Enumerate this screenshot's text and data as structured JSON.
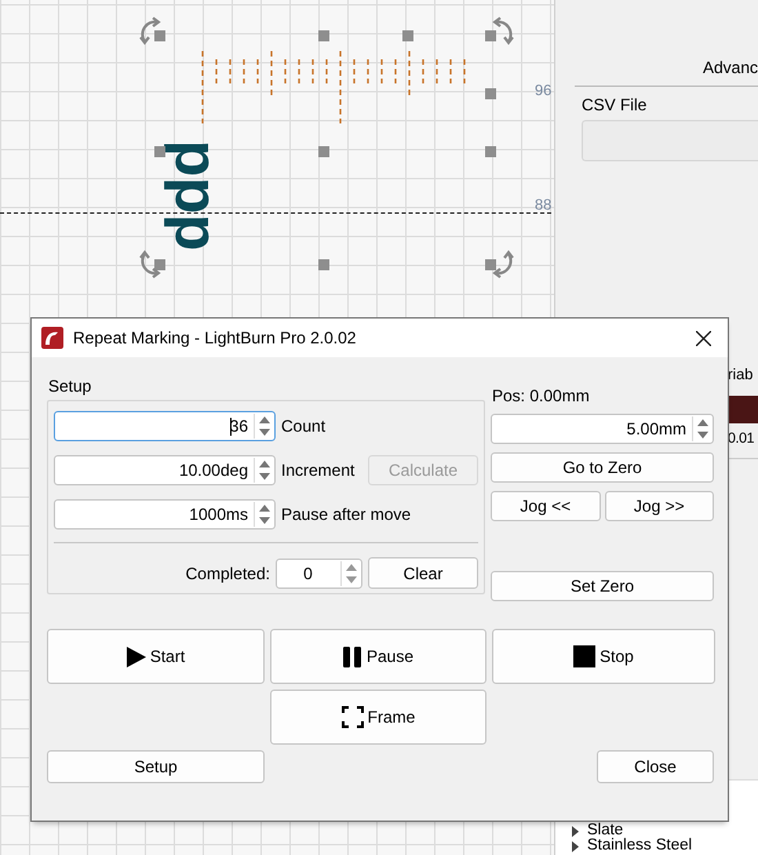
{
  "canvas": {
    "ruler_labels": [
      "96",
      "88"
    ],
    "text_object": "ddd"
  },
  "side_panel": {
    "tab_label": "Advanc",
    "csv_label": "CSV File",
    "column_header": "riab",
    "cell": "0.01",
    "tree_items": [
      "Slate",
      "Stainless Steel"
    ]
  },
  "dialog": {
    "title": "Repeat Marking - LightBurn Pro 2.0.02",
    "setup": {
      "title": "Setup",
      "fields": [
        {
          "value": "36",
          "label": "Count",
          "focused": true
        },
        {
          "value": "10.00deg",
          "label": "Increment",
          "focused": false
        },
        {
          "value": "1000ms",
          "label": "Pause after move",
          "focused": false
        }
      ],
      "calculate_button": {
        "label": "Calculate",
        "disabled": true
      },
      "completed_label": "Completed:",
      "completed_value": "0",
      "clear_button": "Clear"
    },
    "position": {
      "label": "Pos: 0.00mm",
      "step": "5.00mm",
      "go_to_zero": "Go to Zero",
      "jog_back": "Jog <<",
      "jog_forward": "Jog >>",
      "set_zero": "Set Zero"
    },
    "actions": [
      {
        "kind": "start",
        "label": "Start"
      },
      {
        "kind": "pause",
        "label": "Pause"
      },
      {
        "kind": "stop",
        "label": "Stop"
      },
      {
        "kind": "frame",
        "label": "Frame"
      }
    ],
    "setup_button": "Setup",
    "close_button": "Close"
  }
}
